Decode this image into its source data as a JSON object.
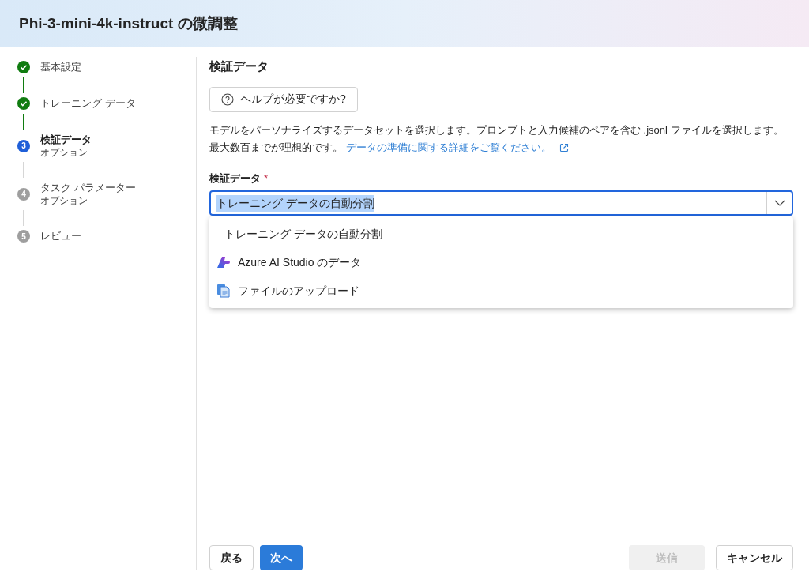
{
  "window": {
    "title": "Phi-3-mini-4k-instruct の微調整"
  },
  "steps": [
    {
      "label": "基本設定",
      "done": true,
      "selected": false
    },
    {
      "label": "トレーニング データ",
      "done": true,
      "selected": false
    },
    {
      "label": "検証データ",
      "sublabel": "オプション",
      "done": false,
      "selected": true,
      "number": "3"
    },
    {
      "label": "タスク パラメーター",
      "sublabel": "オプション",
      "done": false,
      "selected": false,
      "number": "4"
    },
    {
      "label": "レビュー",
      "done": false,
      "selected": false,
      "number": "5"
    }
  ],
  "section": {
    "heading": "検証データ",
    "help_button": "ヘルプが必要ですか?",
    "description": "モデルをパーソナライズするデータセットを選択します。プロンプトと入力候補のペアを含む .jsonl ファイルを選択します。最大数百までが理想的です。",
    "link": "データの準備に関する詳細をご覧ください。"
  },
  "field": {
    "label": "検証データ",
    "required_mark": "*",
    "value": "トレーニング データの自動分割",
    "expanded": true,
    "options": [
      {
        "label": "トレーニング データの自動分割",
        "kind": "plain"
      },
      {
        "label": "Azure AI Studio のデータ",
        "kind": "azure"
      },
      {
        "label": "ファイルのアップロード",
        "kind": "file"
      }
    ]
  },
  "footer": {
    "buttons": [
      {
        "label": "戻る",
        "kind": "secondary",
        "disabled": false
      },
      {
        "label": "次へ",
        "kind": "primary",
        "disabled": false
      },
      {
        "label": "送信",
        "kind": "primary",
        "disabled": true
      },
      {
        "label": "キャンセル",
        "kind": "secondary",
        "disabled": false
      }
    ]
  }
}
